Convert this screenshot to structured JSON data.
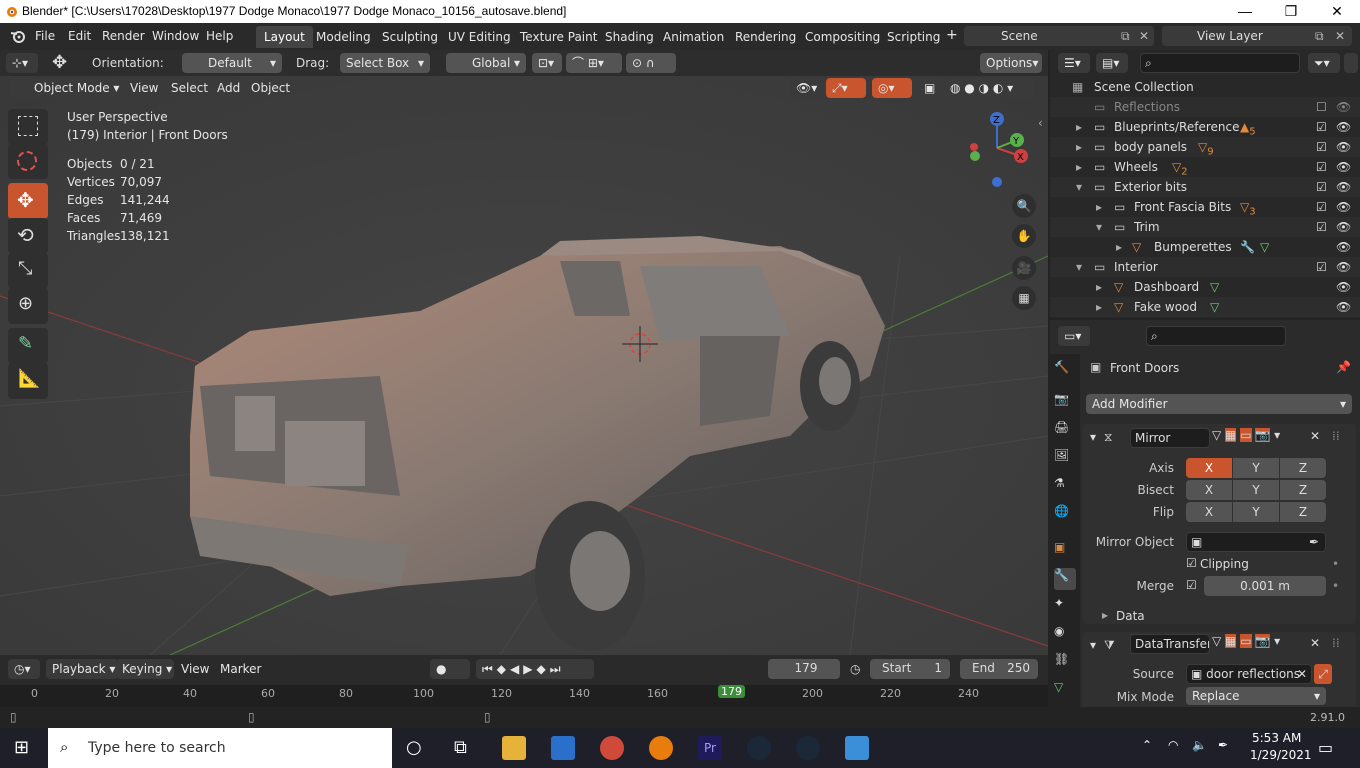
{
  "window": {
    "title": "Blender* [C:\\Users\\17028\\Desktop\\1977 Dodge Monaco\\1977 Dodge Monaco_10156_autosave.blend]",
    "minimize": "—",
    "maximize": "❐",
    "close": "✕"
  },
  "menu": {
    "items": [
      "File",
      "Edit",
      "Render",
      "Window",
      "Help"
    ],
    "workspaces": [
      "Layout",
      "Modeling",
      "Sculpting",
      "UV Editing",
      "Texture Paint",
      "Shading",
      "Animation",
      "Rendering",
      "Compositing",
      "Scripting"
    ],
    "add_tab": "+",
    "scene": "Scene",
    "view_layer": "View Layer"
  },
  "tool_header": {
    "orientation_label": "Orientation:",
    "orientation_value": "Default",
    "drag_label": "Drag:",
    "drag_value": "Select Box",
    "transform_value": "Global",
    "options": "Options"
  },
  "viewport_header": {
    "mode": "Object Mode",
    "menus": [
      "View",
      "Select",
      "Add",
      "Object"
    ]
  },
  "viewport": {
    "perspective": "User Perspective",
    "context": "(179) Interior | Front Doors",
    "stats": [
      {
        "label": "Objects",
        "value": "0 / 21"
      },
      {
        "label": "Vertices",
        "value": "70,097"
      },
      {
        "label": "Edges",
        "value": "141,244"
      },
      {
        "label": "Faces",
        "value": "71,469"
      },
      {
        "label": "Triangles",
        "value": "138,121"
      }
    ],
    "gizmo": {
      "x": "X",
      "y": "Y",
      "z": "Z"
    }
  },
  "timeline": {
    "menus": [
      "Playback",
      "Keying",
      "View",
      "Marker"
    ],
    "current_frame": "179",
    "start_label": "Start",
    "start": "1",
    "end_label": "End",
    "end": "250",
    "ruler": [
      "0",
      "20",
      "40",
      "60",
      "80",
      "100",
      "120",
      "140",
      "160",
      "179",
      "200",
      "220",
      "240"
    ]
  },
  "outliner": {
    "root": "Scene Collection",
    "rows": [
      {
        "name": "Reflections",
        "badge": ""
      },
      {
        "name": "Blueprints/Reference",
        "badge": "5"
      },
      {
        "name": "body panels",
        "badge": "9"
      },
      {
        "name": "Wheels",
        "badge": "2"
      },
      {
        "name": "Exterior bits",
        "badge": ""
      },
      {
        "name": "Front Fascia Bits",
        "badge": "3"
      },
      {
        "name": "Trim",
        "badge": ""
      },
      {
        "name": "Bumperettes",
        "badge": ""
      },
      {
        "name": "Interior",
        "badge": ""
      },
      {
        "name": "Dashboard",
        "badge": ""
      },
      {
        "name": "Fake wood",
        "badge": ""
      }
    ]
  },
  "properties": {
    "object_name": "Front Doors",
    "add_modifier": "Add Modifier",
    "mirror": {
      "name": "Mirror",
      "axis_label": "Axis",
      "bisect_label": "Bisect",
      "flip_label": "Flip",
      "x": "X",
      "y": "Y",
      "z": "Z",
      "mirror_object_label": "Mirror Object",
      "clipping_label": "Clipping",
      "merge_label": "Merge",
      "merge_value": "0.001 m",
      "data_label": "Data"
    },
    "datatransfer": {
      "name": "DataTransfer",
      "source_label": "Source",
      "source_value": "door reflections",
      "mix_mode_label": "Mix Mode",
      "mix_mode_value": "Replace"
    }
  },
  "status": {
    "version": "2.91.0"
  },
  "taskbar": {
    "search_placeholder": "Type here to search",
    "time": "5:53 AM",
    "date": "1/29/2021"
  }
}
